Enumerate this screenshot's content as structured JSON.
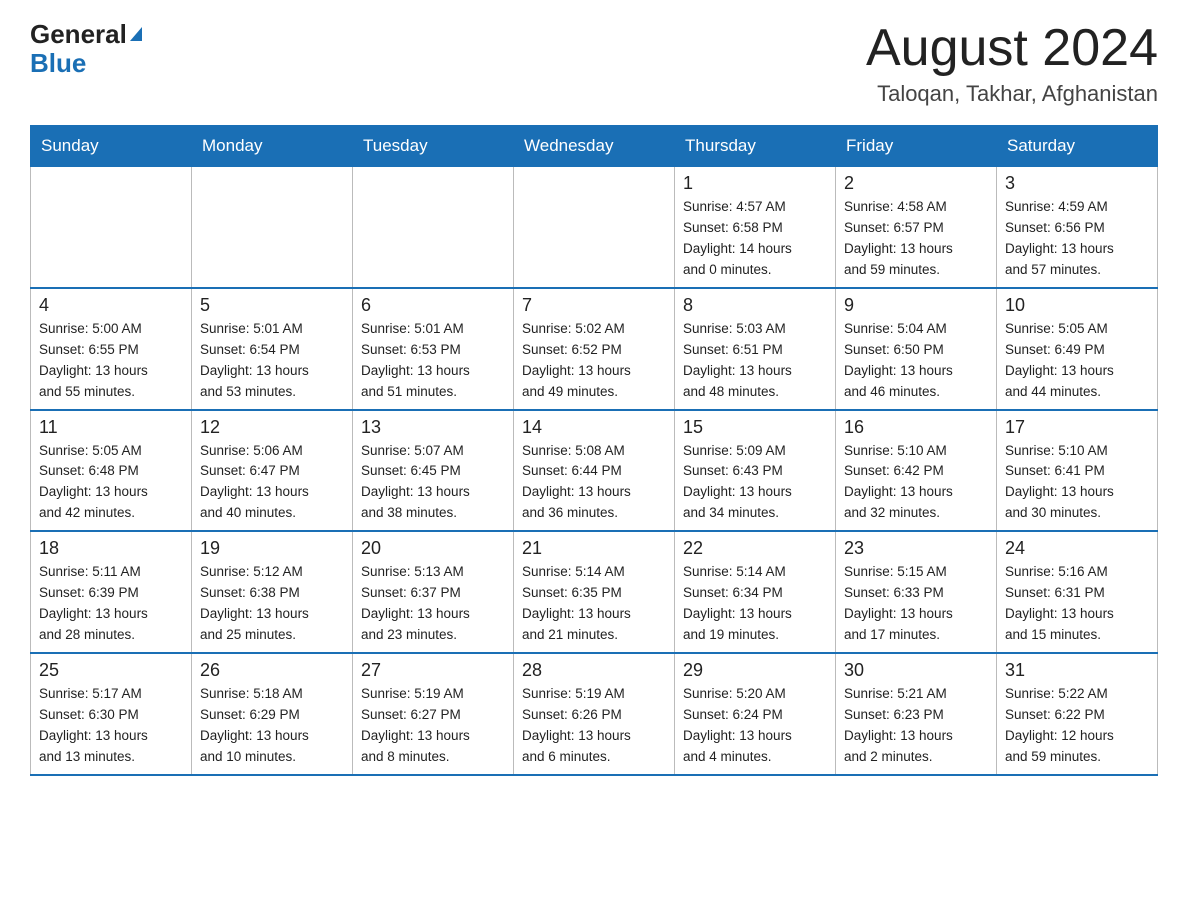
{
  "header": {
    "logo_general": "General",
    "logo_blue": "Blue",
    "month_title": "August 2024",
    "location": "Taloqan, Takhar, Afghanistan"
  },
  "weekdays": [
    "Sunday",
    "Monday",
    "Tuesday",
    "Wednesday",
    "Thursday",
    "Friday",
    "Saturday"
  ],
  "weeks": [
    [
      {
        "day": "",
        "info": ""
      },
      {
        "day": "",
        "info": ""
      },
      {
        "day": "",
        "info": ""
      },
      {
        "day": "",
        "info": ""
      },
      {
        "day": "1",
        "info": "Sunrise: 4:57 AM\nSunset: 6:58 PM\nDaylight: 14 hours\nand 0 minutes."
      },
      {
        "day": "2",
        "info": "Sunrise: 4:58 AM\nSunset: 6:57 PM\nDaylight: 13 hours\nand 59 minutes."
      },
      {
        "day": "3",
        "info": "Sunrise: 4:59 AM\nSunset: 6:56 PM\nDaylight: 13 hours\nand 57 minutes."
      }
    ],
    [
      {
        "day": "4",
        "info": "Sunrise: 5:00 AM\nSunset: 6:55 PM\nDaylight: 13 hours\nand 55 minutes."
      },
      {
        "day": "5",
        "info": "Sunrise: 5:01 AM\nSunset: 6:54 PM\nDaylight: 13 hours\nand 53 minutes."
      },
      {
        "day": "6",
        "info": "Sunrise: 5:01 AM\nSunset: 6:53 PM\nDaylight: 13 hours\nand 51 minutes."
      },
      {
        "day": "7",
        "info": "Sunrise: 5:02 AM\nSunset: 6:52 PM\nDaylight: 13 hours\nand 49 minutes."
      },
      {
        "day": "8",
        "info": "Sunrise: 5:03 AM\nSunset: 6:51 PM\nDaylight: 13 hours\nand 48 minutes."
      },
      {
        "day": "9",
        "info": "Sunrise: 5:04 AM\nSunset: 6:50 PM\nDaylight: 13 hours\nand 46 minutes."
      },
      {
        "day": "10",
        "info": "Sunrise: 5:05 AM\nSunset: 6:49 PM\nDaylight: 13 hours\nand 44 minutes."
      }
    ],
    [
      {
        "day": "11",
        "info": "Sunrise: 5:05 AM\nSunset: 6:48 PM\nDaylight: 13 hours\nand 42 minutes."
      },
      {
        "day": "12",
        "info": "Sunrise: 5:06 AM\nSunset: 6:47 PM\nDaylight: 13 hours\nand 40 minutes."
      },
      {
        "day": "13",
        "info": "Sunrise: 5:07 AM\nSunset: 6:45 PM\nDaylight: 13 hours\nand 38 minutes."
      },
      {
        "day": "14",
        "info": "Sunrise: 5:08 AM\nSunset: 6:44 PM\nDaylight: 13 hours\nand 36 minutes."
      },
      {
        "day": "15",
        "info": "Sunrise: 5:09 AM\nSunset: 6:43 PM\nDaylight: 13 hours\nand 34 minutes."
      },
      {
        "day": "16",
        "info": "Sunrise: 5:10 AM\nSunset: 6:42 PM\nDaylight: 13 hours\nand 32 minutes."
      },
      {
        "day": "17",
        "info": "Sunrise: 5:10 AM\nSunset: 6:41 PM\nDaylight: 13 hours\nand 30 minutes."
      }
    ],
    [
      {
        "day": "18",
        "info": "Sunrise: 5:11 AM\nSunset: 6:39 PM\nDaylight: 13 hours\nand 28 minutes."
      },
      {
        "day": "19",
        "info": "Sunrise: 5:12 AM\nSunset: 6:38 PM\nDaylight: 13 hours\nand 25 minutes."
      },
      {
        "day": "20",
        "info": "Sunrise: 5:13 AM\nSunset: 6:37 PM\nDaylight: 13 hours\nand 23 minutes."
      },
      {
        "day": "21",
        "info": "Sunrise: 5:14 AM\nSunset: 6:35 PM\nDaylight: 13 hours\nand 21 minutes."
      },
      {
        "day": "22",
        "info": "Sunrise: 5:14 AM\nSunset: 6:34 PM\nDaylight: 13 hours\nand 19 minutes."
      },
      {
        "day": "23",
        "info": "Sunrise: 5:15 AM\nSunset: 6:33 PM\nDaylight: 13 hours\nand 17 minutes."
      },
      {
        "day": "24",
        "info": "Sunrise: 5:16 AM\nSunset: 6:31 PM\nDaylight: 13 hours\nand 15 minutes."
      }
    ],
    [
      {
        "day": "25",
        "info": "Sunrise: 5:17 AM\nSunset: 6:30 PM\nDaylight: 13 hours\nand 13 minutes."
      },
      {
        "day": "26",
        "info": "Sunrise: 5:18 AM\nSunset: 6:29 PM\nDaylight: 13 hours\nand 10 minutes."
      },
      {
        "day": "27",
        "info": "Sunrise: 5:19 AM\nSunset: 6:27 PM\nDaylight: 13 hours\nand 8 minutes."
      },
      {
        "day": "28",
        "info": "Sunrise: 5:19 AM\nSunset: 6:26 PM\nDaylight: 13 hours\nand 6 minutes."
      },
      {
        "day": "29",
        "info": "Sunrise: 5:20 AM\nSunset: 6:24 PM\nDaylight: 13 hours\nand 4 minutes."
      },
      {
        "day": "30",
        "info": "Sunrise: 5:21 AM\nSunset: 6:23 PM\nDaylight: 13 hours\nand 2 minutes."
      },
      {
        "day": "31",
        "info": "Sunrise: 5:22 AM\nSunset: 6:22 PM\nDaylight: 12 hours\nand 59 minutes."
      }
    ]
  ]
}
